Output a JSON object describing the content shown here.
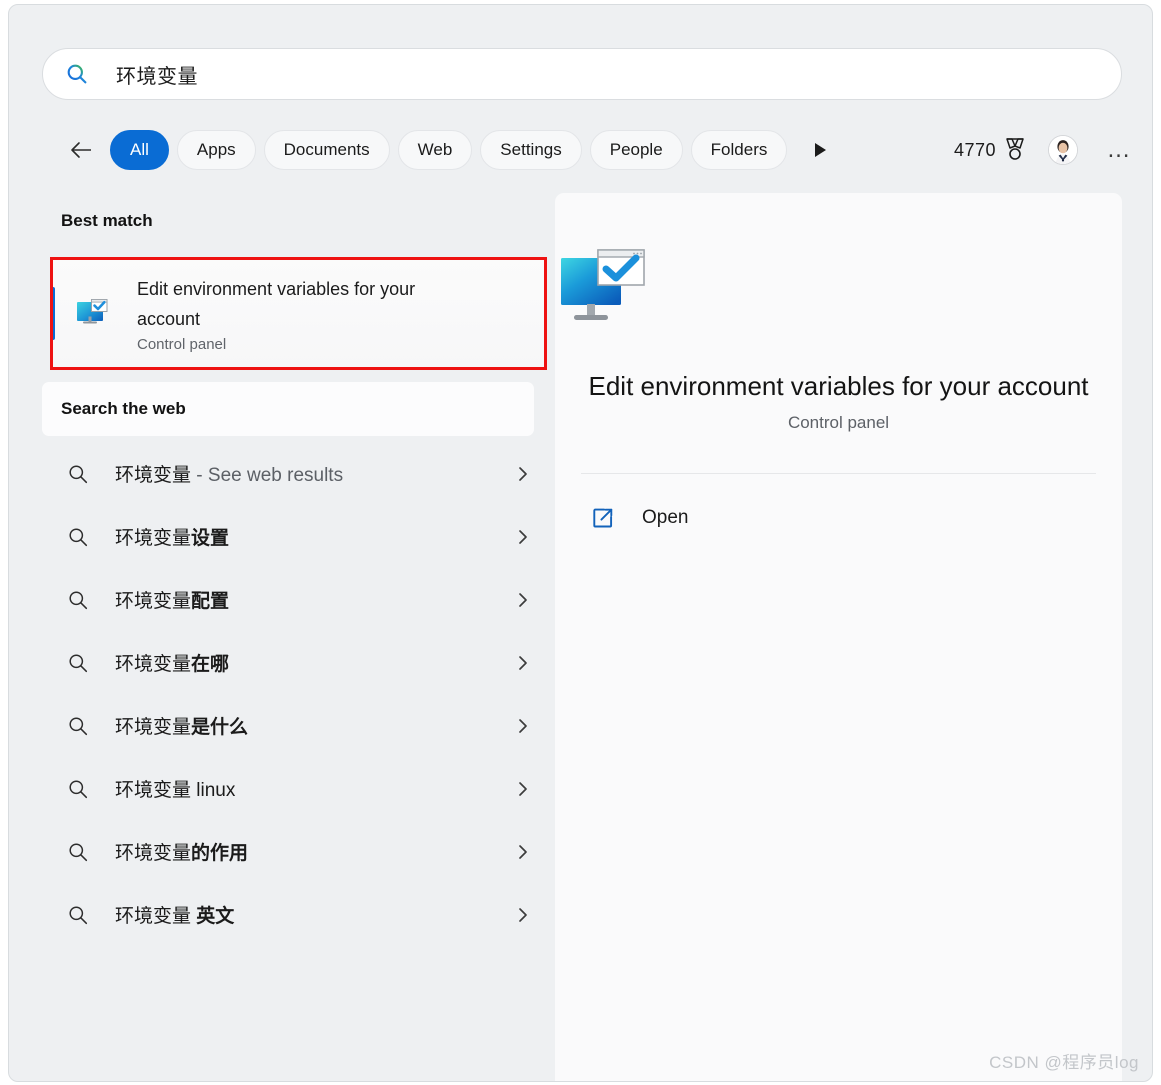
{
  "window": {
    "accent_color": "#0a6cd4",
    "background_color": "#eef0f2",
    "annotation_color": "#ee1212"
  },
  "search": {
    "icon": "search-icon",
    "value": "环境变量",
    "placeholder": "Search"
  },
  "tabbar": {
    "back_icon": "back-arrow-icon",
    "more_icon": "forward-triangle-icon",
    "tabs": [
      {
        "label": "All",
        "active": true
      },
      {
        "label": "Apps",
        "active": false
      },
      {
        "label": "Documents",
        "active": false
      },
      {
        "label": "Web",
        "active": false
      },
      {
        "label": "Settings",
        "active": false
      },
      {
        "label": "People",
        "active": false
      },
      {
        "label": "Folders",
        "active": false
      }
    ],
    "rewards": {
      "count": "4770",
      "icon": "medal-icon"
    },
    "avatar": "user-avatar",
    "overflow": "…"
  },
  "results": {
    "best_match_header": "Best match",
    "best_match": {
      "title": "Edit environment variables for your account",
      "subtitle": "Control panel",
      "icon": "environment-variables-icon",
      "selected": true
    },
    "web_header": "Search the web",
    "suggestions": [
      {
        "query": "环境变量",
        "bold": "",
        "suffix_dim": " - See web results"
      },
      {
        "query": "环境变量",
        "bold": "设置",
        "suffix_dim": ""
      },
      {
        "query": "环境变量",
        "bold": "配置",
        "suffix_dim": ""
      },
      {
        "query": "环境变量",
        "bold": "在哪",
        "suffix_dim": ""
      },
      {
        "query": "环境变量",
        "bold": "是什么",
        "suffix_dim": ""
      },
      {
        "query": "环境变量 linux",
        "bold": "",
        "suffix_dim": ""
      },
      {
        "query": "环境变量",
        "bold": "的作用",
        "suffix_dim": ""
      },
      {
        "query": "环境变量 ",
        "bold": "英文",
        "suffix_dim": ""
      }
    ]
  },
  "preview": {
    "icon": "environment-variables-icon",
    "title": "Edit environment variables for your account",
    "subtitle": "Control panel",
    "actions": [
      {
        "label": "Open",
        "icon": "open-external-icon"
      }
    ]
  },
  "watermark": "CSDN @程序员log"
}
